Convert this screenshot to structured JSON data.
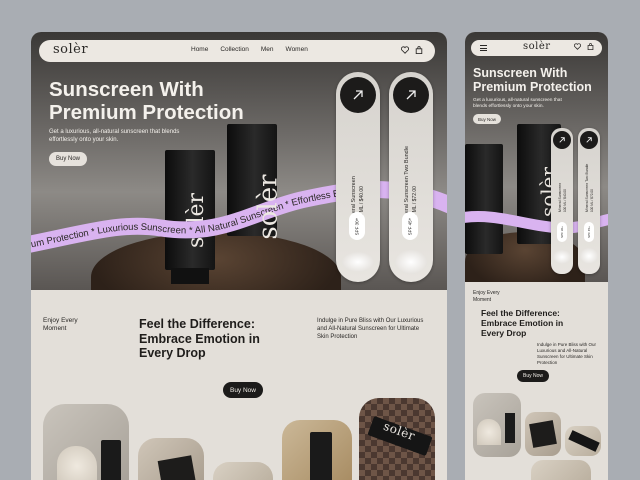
{
  "brand": {
    "logo": "solèr"
  },
  "desktop": {
    "nav": {
      "items": [
        "Home",
        "Collection",
        "Men",
        "Women"
      ]
    },
    "hero": {
      "title_line1": "Sunscreen With",
      "title_line2": "Premium Protection",
      "subtitle": "Get a luxurious, all-natural sunscreen that blends effortlessly onto your skin.",
      "cta": "Buy Now",
      "ribbon_text": "mium Protection * Luxurious Sunscreen * All Natural Sunscreen * Effortless Bl"
    },
    "products": [
      {
        "name": "Mineral Sunscreen",
        "detail": "100 ML / $40.00",
        "spf": "SPF 30+"
      },
      {
        "name": "Mineral Sunscreen Two Bundle",
        "detail": "100 ML / $72.00",
        "spf": "SPF 45+"
      }
    ],
    "feature": {
      "kicker": "Enjoy Every Moment",
      "heading": "Feel the Difference: Embrace Emotion in Every Drop",
      "description": "Indulge in Pure Bliss with Our Luxurious and All-Natural Sunscreen for Ultimate Skin Protection",
      "cta": "Buy Now"
    }
  },
  "mobile": {
    "hero": {
      "title_line1": "Sunscreen With",
      "title_line2": "Premium Protection",
      "subtitle": "Get a luxurious, all-natural sunscreen that blends effortlessly onto your skin.",
      "cta": "Buy Now"
    },
    "products": [
      {
        "name": "Mineral Sunscreen",
        "detail": "100 ML / $40.00",
        "spf": "SPF 30+"
      },
      {
        "name": "Mineral Sunscreen Two Bundle",
        "detail": "100 ML / $72.00",
        "spf": "SPF 45+"
      }
    ],
    "feature": {
      "kicker": "Enjoy Every Moment",
      "heading": "Feel the Difference: Embrace Emotion in Every Drop",
      "description": "Indulge in Pure Bliss with Our Luxurious and All-Natural Sunscreen for Ultimate Skin Protection",
      "cta": "Buy Now"
    }
  },
  "colors": {
    "accent_ribbon": "#d9b3f0",
    "dark": "#1c1b1a",
    "background": "#e3dfd9"
  },
  "icons": [
    "heart-icon",
    "bag-icon",
    "arrow-up-right-icon",
    "hamburger-icon"
  ]
}
